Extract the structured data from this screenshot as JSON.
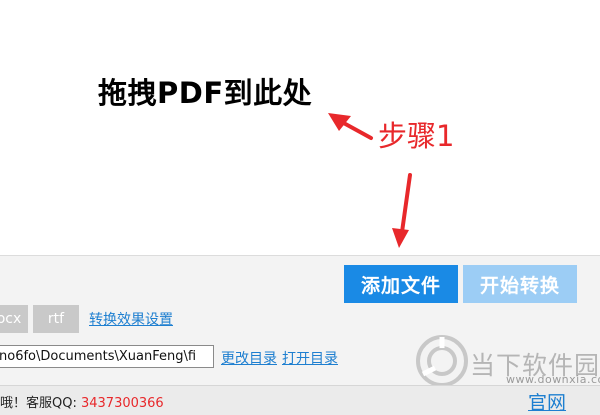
{
  "drop_zone": {
    "title": "拖拽PDF到此处"
  },
  "annotation": {
    "step_label": "步骤1",
    "color": "#e8282b"
  },
  "toolbar": {
    "add_file": "添加文件",
    "start_convert": "开始转换",
    "add_color": "#1a8ae5",
    "start_color": "#9ccdf5"
  },
  "formats": {
    "docx": "ocx",
    "rtf": "rtf",
    "settings_link": "转换效果设置"
  },
  "output": {
    "path_value": "no6fo\\Documents\\XuanFeng\\fi",
    "change_dir": "更改目录",
    "open_dir": "打开目录"
  },
  "footer": {
    "notice": "哦！客服QQ: ",
    "qq": "3437300366",
    "site_link": "官网"
  },
  "watermark": {
    "text": "当下软件园",
    "url": "www.downxia.com"
  }
}
